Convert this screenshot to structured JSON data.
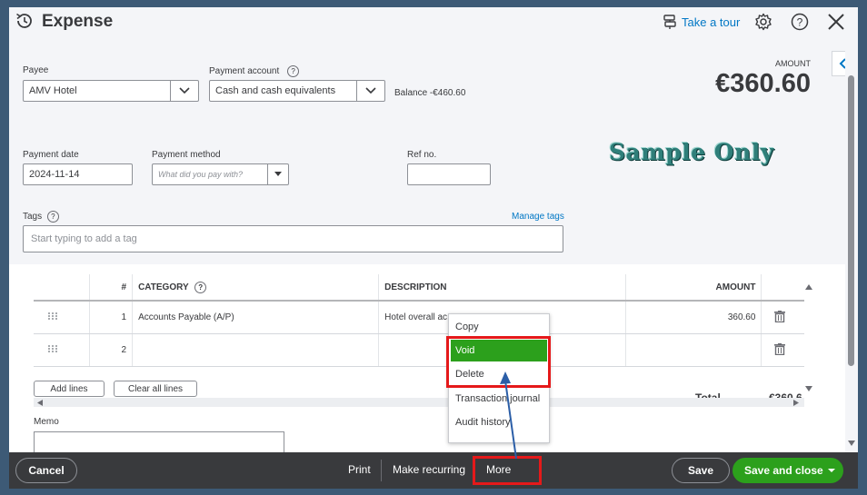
{
  "header": {
    "title": "Expense",
    "tour_label": "Take a tour"
  },
  "form": {
    "payee_label": "Payee",
    "payee_value": "AMV Hotel",
    "account_label": "Payment account",
    "account_value": "Cash and cash equivalents",
    "balance_text": "Balance -€460.60",
    "amount_label": "AMOUNT",
    "amount_value": "€360.60",
    "date_label": "Payment date",
    "date_value": "2024-11-14",
    "method_label": "Payment method",
    "method_placeholder": "What did you pay with?",
    "ref_label": "Ref no.",
    "ref_value": "",
    "tags_label": "Tags",
    "manage_tags": "Manage tags",
    "tags_placeholder": "Start typing to add a tag"
  },
  "watermark": "Sample Only",
  "table": {
    "headers": [
      "#",
      "CATEGORY",
      "DESCRIPTION",
      "AMOUNT"
    ],
    "rows": [
      {
        "num": "1",
        "category": "Accounts Payable (A/P)",
        "description": "Hotel overall ac",
        "amount": "360.60"
      },
      {
        "num": "2",
        "category": "",
        "description": "",
        "amount": ""
      }
    ],
    "add_lines": "Add lines",
    "clear_lines": "Clear all lines",
    "total_label": "Total",
    "total_value": "€360.6"
  },
  "memo_label": "Memo",
  "menu": {
    "items": [
      "Copy",
      "Void",
      "Delete",
      "Transaction journal",
      "Audit history"
    ],
    "highlight_color": "#2ca01c",
    "annotation_color": "#e5191a"
  },
  "footer": {
    "cancel": "Cancel",
    "print": "Print",
    "recurring": "Make recurring",
    "more": "More",
    "save": "Save",
    "save_close": "Save and close"
  },
  "colors": {
    "primary_green": "#2ca01c",
    "link_blue": "#0077c5",
    "footer_bg": "#393a3d"
  }
}
